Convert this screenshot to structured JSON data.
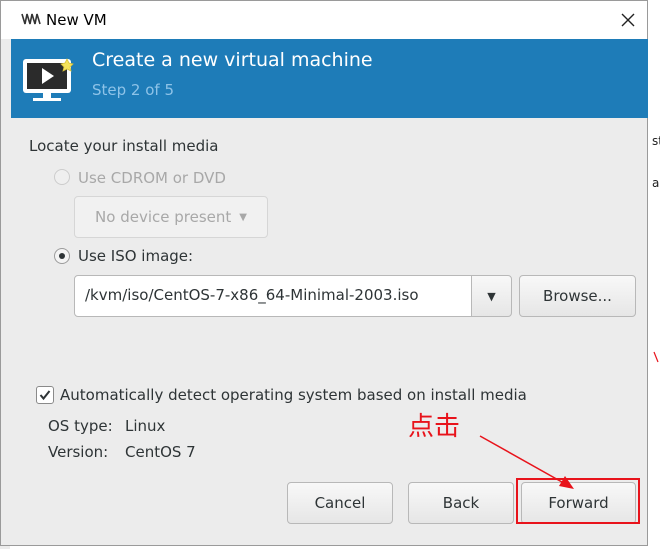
{
  "window": {
    "title": "New VM",
    "icon": "virt-manager-icon"
  },
  "header": {
    "title": "Create a new virtual machine",
    "step": "Step 2 of 5",
    "icon": "vm-monitor-icon",
    "bg_color": "#1e7cb8"
  },
  "media": {
    "section_label": "Locate your install media",
    "cdrom_label": "Use CDROM or DVD",
    "cdrom_device": "No device present",
    "iso_label": "Use ISO image:",
    "iso_path": "/kvm/iso/CentOS-7-x86_64-Minimal-2003.iso",
    "browse_label": "Browse..."
  },
  "os_detect": {
    "auto_label": "Automatically detect operating system based on install media",
    "auto_checked": true,
    "os_type_label": "OS type:",
    "os_type_value": "Linux",
    "version_label": "Version:",
    "version_value": "CentOS 7"
  },
  "buttons": {
    "cancel": "Cancel",
    "back": "Back",
    "forward": "Forward"
  },
  "annotation": {
    "text": "点击",
    "color": "#e8131b"
  }
}
